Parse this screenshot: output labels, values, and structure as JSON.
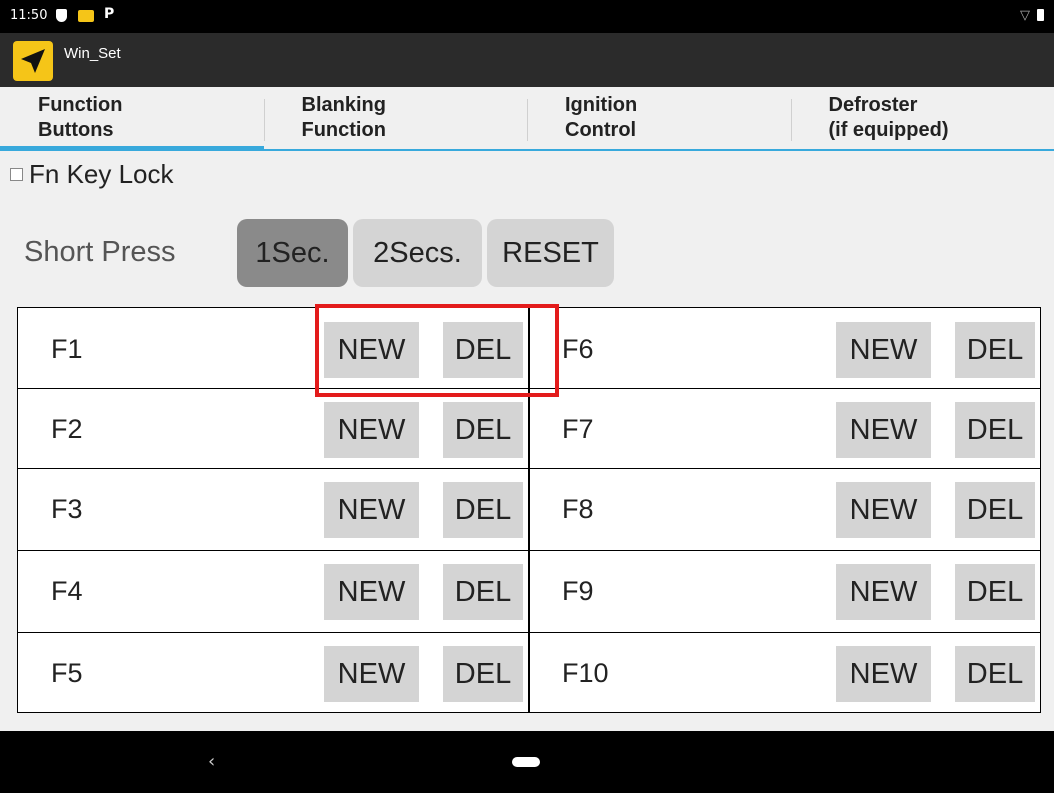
{
  "status_bar": {
    "time": "11:50",
    "p_glyph": "P"
  },
  "app_bar": {
    "title": "Win_Set",
    "icon": "navigation-arrow-icon"
  },
  "tabs": [
    {
      "line1": "Function",
      "line2": "Buttons",
      "active": true
    },
    {
      "line1": "Blanking",
      "line2": "Function",
      "active": false
    },
    {
      "line1": "Ignition",
      "line2": "Control",
      "active": false
    },
    {
      "line1": "Defroster",
      "line2": "(if equipped)",
      "active": false
    }
  ],
  "fn_key_lock": {
    "label": "Fn Key Lock",
    "checked": false
  },
  "short_press": {
    "label": "Short Press",
    "options": [
      "1Sec.",
      "2Secs.",
      "RESET"
    ],
    "selected": "1Sec."
  },
  "function_keys": {
    "new_label": "NEW",
    "del_label": "DEL",
    "left": [
      "F1",
      "F2",
      "F3",
      "F4",
      "F5"
    ],
    "right": [
      "F6",
      "F7",
      "F8",
      "F9",
      "F10"
    ]
  },
  "nav_bar": {
    "back_glyph": "‹"
  },
  "colors": {
    "accent": "#38a9dc",
    "highlight": "#e31b1b",
    "app_icon": "#f5c518"
  }
}
